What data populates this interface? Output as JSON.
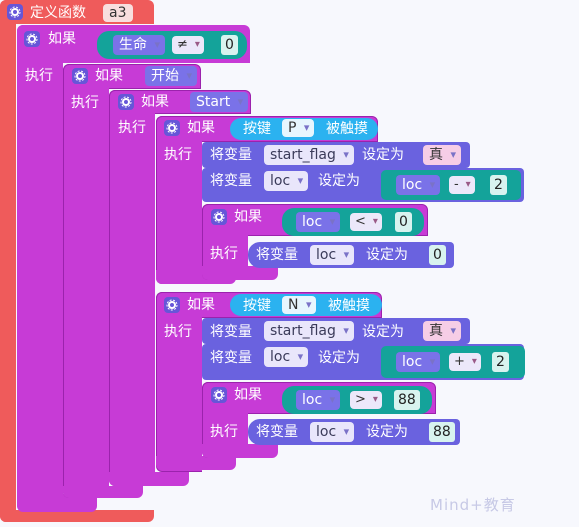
{
  "define": {
    "label": "定义函数",
    "name": "a3"
  },
  "kw": {
    "if": "如果",
    "do": "执行",
    "set_var": "将变量",
    "set_to": "设定为",
    "pressed": "被触摸",
    "key": "按键"
  },
  "cond1": {
    "var": "生命",
    "op": "≠",
    "val": "0"
  },
  "cond2": {
    "var": "开始"
  },
  "cond3": {
    "var": "Start"
  },
  "groupP": {
    "key": "P",
    "set1": {
      "var": "start_flag",
      "val": "真"
    },
    "set2": {
      "var": "loc",
      "expr_var": "loc",
      "op": "-",
      "num": "2"
    },
    "inner_if": {
      "var": "loc",
      "op": "<",
      "num": "0"
    },
    "inner_set": {
      "var": "loc",
      "num": "0"
    }
  },
  "groupN": {
    "key": "N",
    "set1": {
      "var": "start_flag",
      "val": "真"
    },
    "set2": {
      "var": "loc",
      "expr_var": "loc",
      "op": "+",
      "num": "2"
    },
    "inner_if": {
      "var": "loc",
      "op": ">",
      "num": "88"
    },
    "inner_set": {
      "var": "loc",
      "num": "88"
    }
  },
  "watermark": "Mind+教育",
  "colors": {
    "function": "#ef5b5b",
    "control": "#c73bd6",
    "sensor": "#2bb2f0",
    "variable": "#6a62df",
    "operator": "#14a39a"
  }
}
